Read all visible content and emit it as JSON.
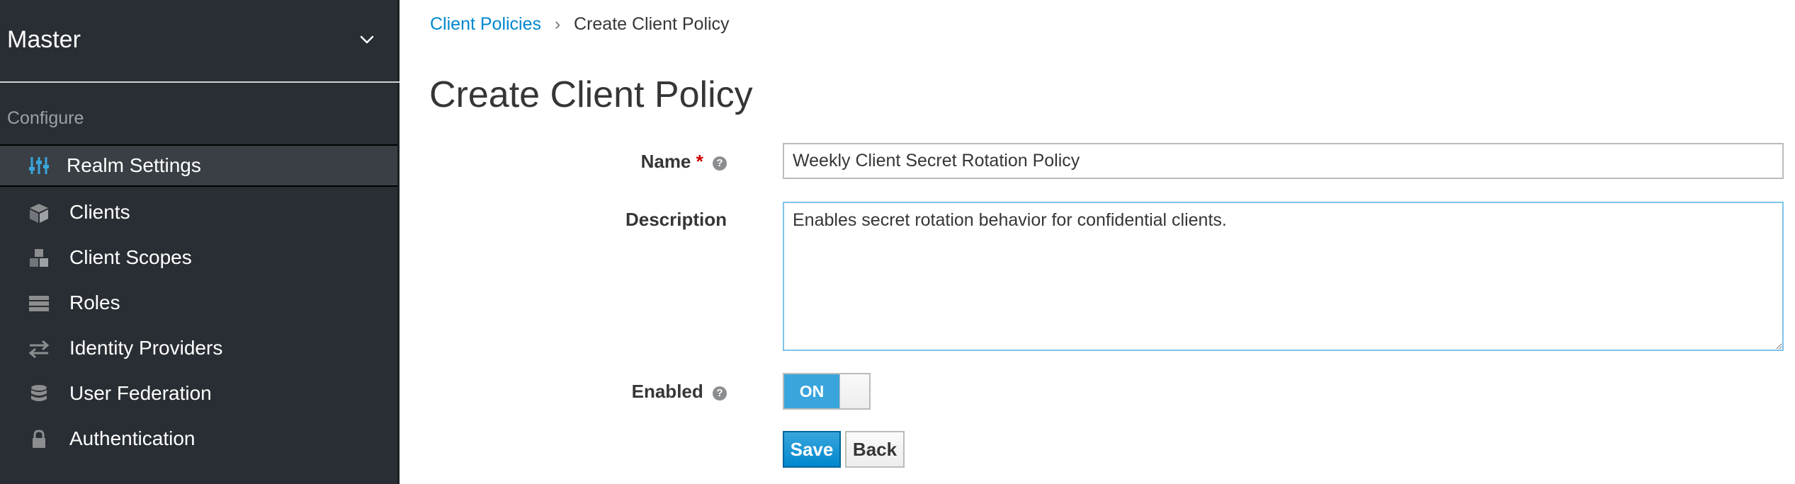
{
  "sidebar": {
    "realm": "Master",
    "section": "Configure",
    "items": [
      {
        "label": "Realm Settings",
        "icon": "sliders-icon",
        "active": true
      },
      {
        "label": "Clients",
        "icon": "cube-icon"
      },
      {
        "label": "Client Scopes",
        "icon": "cubes-icon"
      },
      {
        "label": "Roles",
        "icon": "server-icon"
      },
      {
        "label": "Identity Providers",
        "icon": "exchange-icon"
      },
      {
        "label": "User Federation",
        "icon": "database-icon"
      },
      {
        "label": "Authentication",
        "icon": "lock-icon"
      }
    ]
  },
  "breadcrumb": {
    "parent": "Client Policies",
    "separator": "›",
    "current": "Create Client Policy"
  },
  "page": {
    "title": "Create Client Policy"
  },
  "form": {
    "name_label": "Name",
    "required_mark": "*",
    "name_value": "Weekly Client Secret Rotation Policy",
    "description_label": "Description",
    "description_value": "Enables secret rotation behavior for confidential clients.",
    "enabled_label": "Enabled",
    "enabled_state": "ON",
    "help_glyph": "?"
  },
  "buttons": {
    "save": "Save",
    "back": "Back"
  },
  "colors": {
    "sidebar_bg": "#292e34",
    "active_item_bg": "#393f44",
    "link": "#0088ce",
    "primary": "#0088ce",
    "toggle_on": "#39a5dc",
    "required": "#cc0000"
  }
}
